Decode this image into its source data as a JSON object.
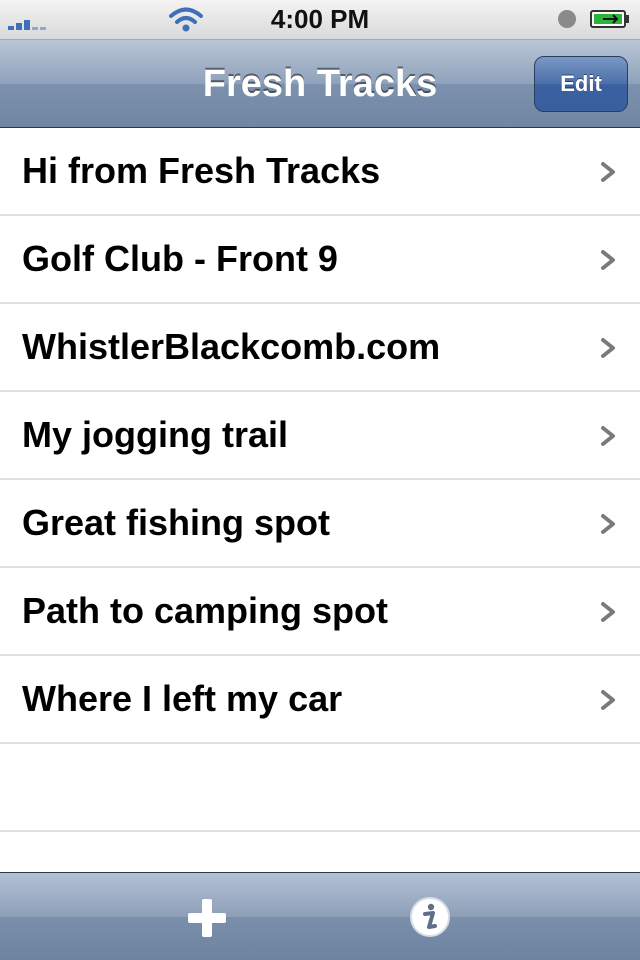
{
  "status_bar": {
    "time": "4:00 PM"
  },
  "nav_bar": {
    "title": "Fresh Tracks",
    "edit_label": "Edit"
  },
  "tracks": [
    {
      "label": "Hi from Fresh Tracks"
    },
    {
      "label": "Golf Club - Front 9"
    },
    {
      "label": "WhistlerBlackcomb.com"
    },
    {
      "label": "My jogging trail"
    },
    {
      "label": "Great fishing spot"
    },
    {
      "label": "Path to camping spot"
    },
    {
      "label": "Where I left my car"
    }
  ],
  "toolbar": {
    "add_icon": "plus-icon",
    "info_icon": "info-icon"
  },
  "icons": {
    "row_accessory": "chevron-right-icon",
    "signal": "signal-strength-icon",
    "wifi": "wifi-icon",
    "battery": "battery-charging-icon",
    "orientation_lock": "orientation-lock-icon"
  },
  "colors": {
    "nav_bar": "#8fa2bb",
    "edit_button": "#4b6fa8",
    "text": "#000000",
    "chevron": "#7a7a7a"
  }
}
